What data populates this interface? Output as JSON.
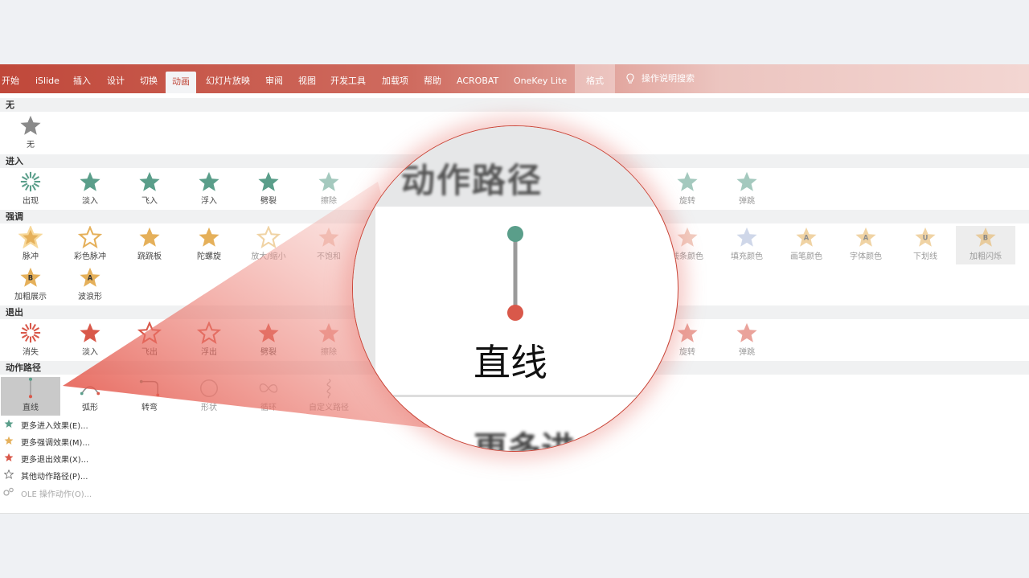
{
  "ribbon": {
    "tabs": [
      "开始",
      "iSlide",
      "插入",
      "设计",
      "切换",
      "动画",
      "幻灯片放映",
      "审阅",
      "视图",
      "开发工具",
      "加载项",
      "帮助",
      "ACROBAT",
      "OneKey Lite",
      "格式"
    ],
    "active_tab": "动画",
    "tell_me": "操作说明搜索"
  },
  "sections": {
    "none": "无",
    "entrance": "进入",
    "emphasis": "强调",
    "exit": "退出",
    "motion_paths": "动作路径"
  },
  "none_items": [
    "无"
  ],
  "entrance_items": [
    "出现",
    "淡入",
    "飞入",
    "浮入",
    "劈裂",
    "擦除",
    "旋转",
    "弹跳"
  ],
  "emphasis_items": [
    "脉冲",
    "彩色脉冲",
    "跷跷板",
    "陀螺旋",
    "放大/缩小",
    "不饱和",
    "线条颜色",
    "填充颜色",
    "画笔颜色",
    "字体颜色",
    "下划线",
    "加粗闪烁",
    "加粗展示",
    "波浪形"
  ],
  "exit_items": [
    "消失",
    "淡入",
    "飞出",
    "浮出",
    "劈裂",
    "擦除",
    "旋转",
    "弹跳"
  ],
  "motion_items": [
    "直线",
    "弧形",
    "转弯",
    "形状",
    "循环",
    "自定义路径"
  ],
  "more_effects": [
    "更多进入效果(E)...",
    "更多强调效果(M)...",
    "更多退出效果(X)...",
    "其他动作路径(P)...",
    "OLE 操作动作(O)..."
  ],
  "magnifier": {
    "header": "动作路径",
    "label": "直线",
    "more": "更多进"
  },
  "colors": {
    "ribbon_red": "#c0483a",
    "entrance_green": "#5a9e8a",
    "emphasis_gold": "#e5b05a",
    "exit_red": "#d9584a",
    "star_gray": "#8a8a8a",
    "selected_bg": "#c9c9c9"
  }
}
